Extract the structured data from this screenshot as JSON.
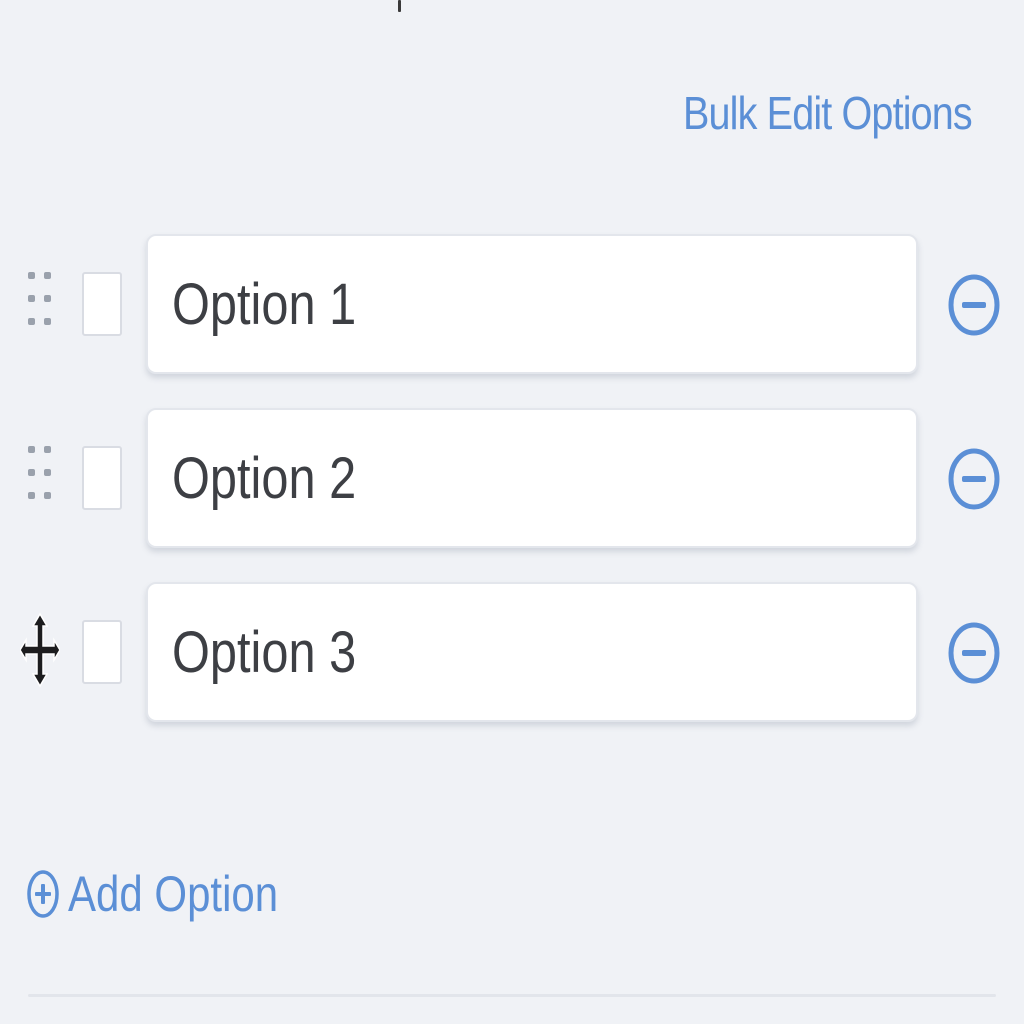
{
  "bulk_edit": {
    "label": "Bulk Edit Options"
  },
  "options": [
    {
      "label": "Option 1",
      "handle_icon": "drag-dots-icon",
      "checked": false
    },
    {
      "label": "Option 2",
      "handle_icon": "drag-dots-icon",
      "checked": false
    },
    {
      "label": "Option 3",
      "handle_icon": "move-cursor-icon",
      "checked": false
    }
  ],
  "add_option": {
    "label": "Add Option",
    "icon": "plus-circle-icon"
  },
  "colors": {
    "accent": "#5b8fd6",
    "background": "#f0f2f6",
    "text": "#3d3f44"
  }
}
